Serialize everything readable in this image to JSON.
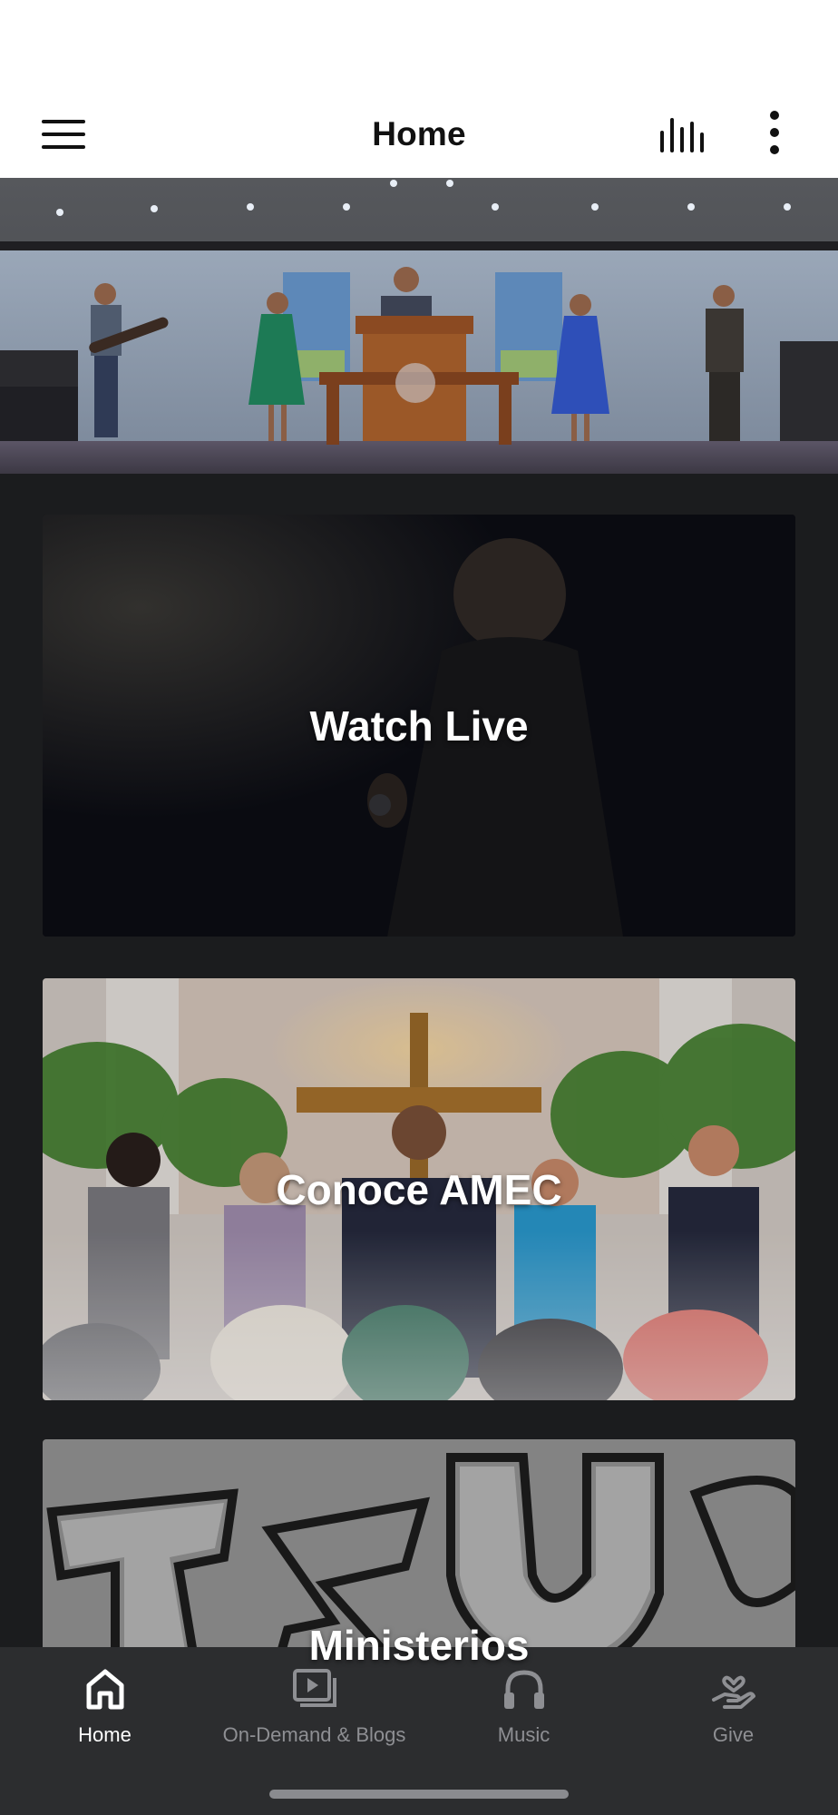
{
  "header": {
    "title": "Home",
    "menu_icon": "hamburger-menu-icon",
    "audio_icon": "audio-bars-icon",
    "more_icon": "vertical-dots-icon"
  },
  "cards": [
    {
      "title": "Watch Live"
    },
    {
      "title": "Conoce AMEC"
    },
    {
      "title": "Ministerios"
    }
  ],
  "bottom_nav": [
    {
      "label": "Home",
      "icon": "home-icon",
      "active": true
    },
    {
      "label": "On-Demand & Blogs",
      "icon": "video-library-icon",
      "active": false
    },
    {
      "label": "Music",
      "icon": "headphones-icon",
      "active": false
    },
    {
      "label": "Give",
      "icon": "heart-hand-icon",
      "active": false
    }
  ],
  "colors": {
    "background": "#1b1c1e",
    "header_bg": "#ffffff",
    "nav_bg": "#2c2d2f",
    "nav_active": "#ffffff",
    "nav_inactive": "#8e8f93"
  }
}
